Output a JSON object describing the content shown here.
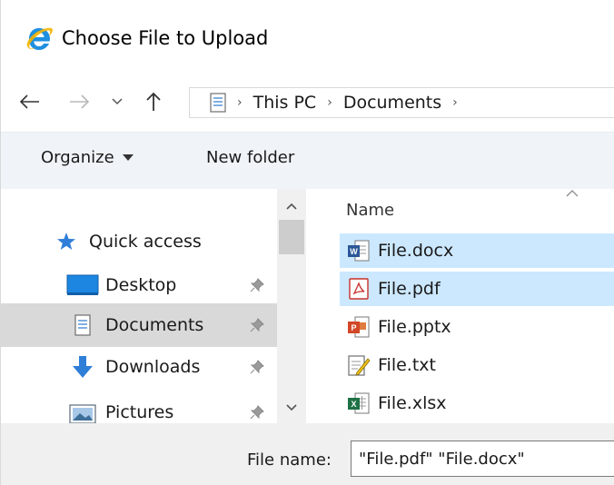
{
  "window": {
    "title": "Choose File to Upload"
  },
  "breadcrumb": {
    "items": [
      "This PC",
      "Documents"
    ]
  },
  "toolbar": {
    "organize_label": "Organize",
    "new_folder_label": "New folder"
  },
  "navpane": {
    "items": [
      {
        "label": "Quick access",
        "icon": "star-icon"
      },
      {
        "label": "Desktop",
        "icon": "desktop-icon"
      },
      {
        "label": "Documents",
        "icon": "documents-icon"
      },
      {
        "label": "Downloads",
        "icon": "download-icon"
      },
      {
        "label": "Pictures",
        "icon": "pictures-icon"
      }
    ]
  },
  "filelist": {
    "column_name": "Name",
    "files": [
      {
        "name": "File.docx",
        "type": "word",
        "selected": true
      },
      {
        "name": "File.pdf",
        "type": "pdf",
        "selected": true
      },
      {
        "name": "File.pptx",
        "type": "powerpoint",
        "selected": false
      },
      {
        "name": "File.txt",
        "type": "text",
        "selected": false
      },
      {
        "name": "File.xlsx",
        "type": "excel",
        "selected": false
      }
    ]
  },
  "filename": {
    "label": "File name:",
    "value": "\"File.pdf\" \"File.docx\""
  },
  "colors": {
    "selection": "#cce8ff",
    "nav_selected": "#d9d9d9",
    "toolbar_bg": "#f0f4f9",
    "footer_bg": "#f0f0f0"
  }
}
